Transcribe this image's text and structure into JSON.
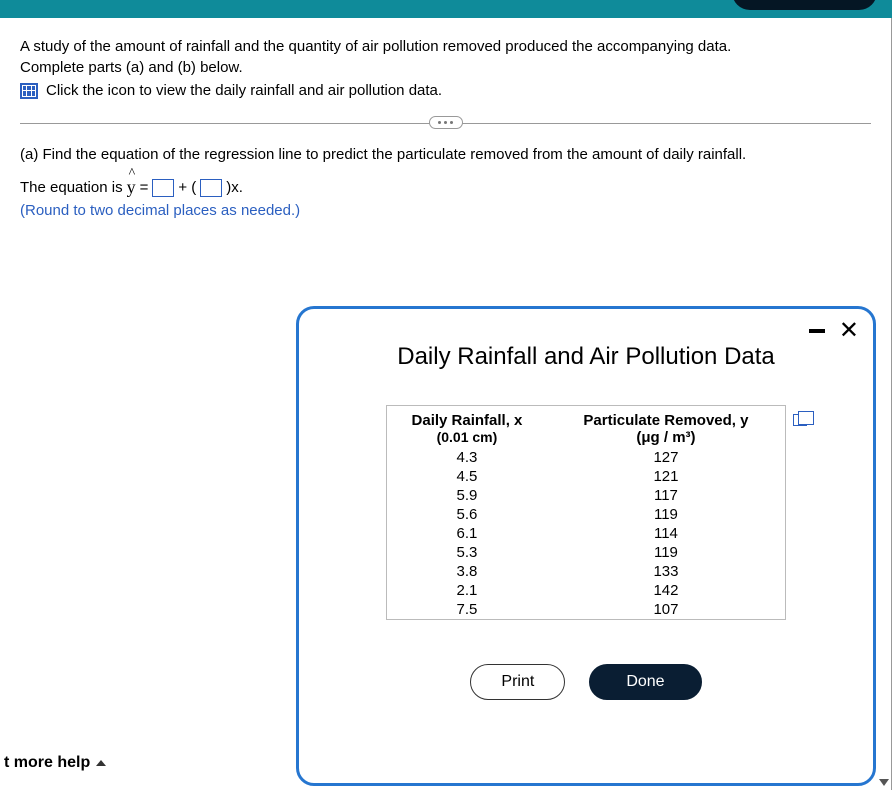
{
  "problem": {
    "line1": "A study of the amount of rainfall and the quantity of air pollution removed produced the accompanying data.",
    "line2": "Complete parts (a) and (b) below.",
    "link": "Click the icon to view the daily rainfall and air pollution data."
  },
  "partA": {
    "prompt": "(a) Find the equation of the regression line to predict the particulate removed from the amount of daily rainfall.",
    "eq_prefix": "The equation is ",
    "eq_y": "y",
    "eq_equals": " = ",
    "eq_plus": " + (",
    "eq_suffix": ")x.",
    "round_note": "(Round to two decimal places as needed.)"
  },
  "help_button": "t more help",
  "modal": {
    "title": "Daily Rainfall and Air Pollution Data",
    "col1_header": "Daily Rainfall, x",
    "col1_unit": "(0.01 cm)",
    "col2_header": "Particulate Removed, y",
    "col2_unit": "(μg / m³)",
    "rows": [
      {
        "x": "4.3",
        "y": "127"
      },
      {
        "x": "4.5",
        "y": "121"
      },
      {
        "x": "5.9",
        "y": "117"
      },
      {
        "x": "5.6",
        "y": "119"
      },
      {
        "x": "6.1",
        "y": "114"
      },
      {
        "x": "5.3",
        "y": "119"
      },
      {
        "x": "3.8",
        "y": "133"
      },
      {
        "x": "2.1",
        "y": "142"
      },
      {
        "x": "7.5",
        "y": "107"
      }
    ],
    "print": "Print",
    "done": "Done"
  }
}
